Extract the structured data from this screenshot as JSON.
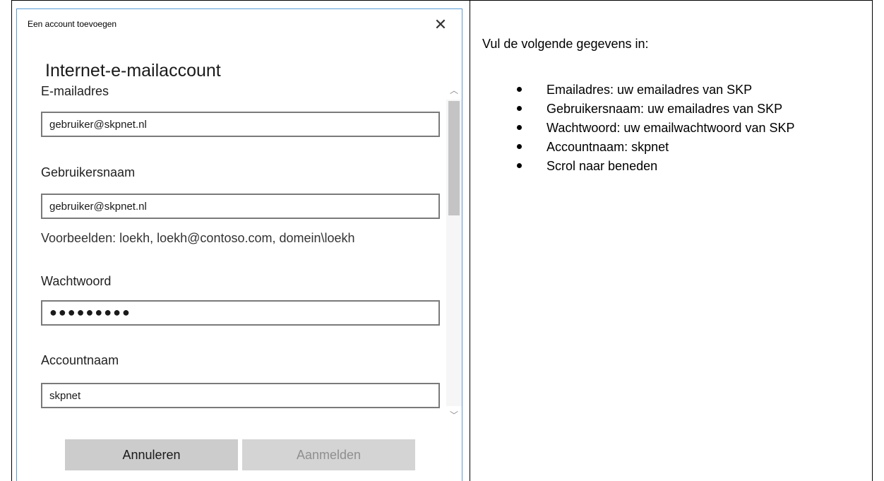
{
  "dialog": {
    "title": "Een account toevoegen",
    "close_glyph": "✕",
    "heading": "Internet-e-mailaccount",
    "fields": [
      {
        "label": "E-mailadres",
        "value": "gebruiker@skpnet.nl"
      },
      {
        "label": "Gebruikersnaam",
        "value": "gebruiker@skpnet.nl"
      },
      {
        "label": "Wachtwoord",
        "value": "●●●●●●●●●"
      },
      {
        "label": "Accountnaam",
        "value": "skpnet"
      }
    ],
    "hint": "Voorbeelden: loekh, loekh@contoso.com, domein\\loekh",
    "scroll_up_glyph": "︿",
    "scroll_down_glyph": "﹀",
    "buttons": {
      "cancel": "Annuleren",
      "signin": "Aanmelden"
    }
  },
  "instructions": {
    "intro": "Vul de volgende gegevens in:",
    "items": [
      "Emailadres: uw emailadres van SKP",
      "Gebruikersnaam: uw emailadres van SKP",
      "Wachtwoord: uw emailwachtwoord van SKP",
      "Accountnaam: skpnet",
      "Scrol naar beneden"
    ]
  },
  "colors": {
    "dialog_border": "#5b9bd5",
    "input_border": "#7a7a7a",
    "button_cancel_bg": "#cccccc",
    "button_disabled_text": "#8f8f8f"
  }
}
